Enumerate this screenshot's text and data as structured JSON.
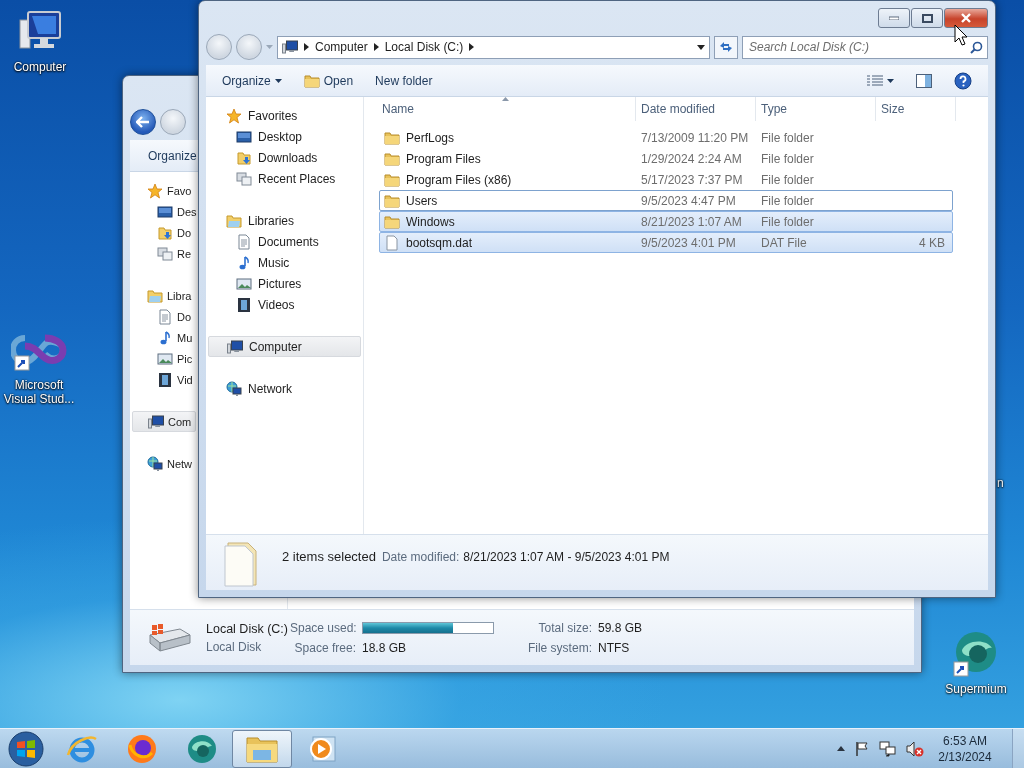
{
  "desktop_icons": [
    {
      "kind": "computer",
      "label": "Computer"
    },
    {
      "kind": "visual-studio",
      "label": "Microsoft Visual Stud..."
    },
    {
      "kind": "supermium",
      "label": "Supermium"
    },
    {
      "kind": "fragment",
      "label": "n"
    }
  ],
  "back_window": {
    "toolbar": {
      "organize": "Organize"
    },
    "nav": [
      {
        "kind": "star",
        "label": "Favo",
        "selected": false,
        "children": [
          {
            "kind": "desktop",
            "label": "Des",
            "selected": false
          },
          {
            "kind": "downloads",
            "label": "Do",
            "selected": false
          },
          {
            "kind": "recent",
            "label": "Re",
            "selected": false
          }
        ]
      },
      {
        "kind": "library",
        "label": "Libra",
        "selected": false,
        "children": [
          {
            "kind": "documents",
            "label": "Do",
            "selected": false
          },
          {
            "kind": "music",
            "label": "Mu",
            "selected": false
          },
          {
            "kind": "pictures",
            "label": "Pic",
            "selected": false
          },
          {
            "kind": "videos",
            "label": "Vid",
            "selected": false
          }
        ]
      },
      {
        "kind": "computer",
        "label": "Com",
        "selected": true
      },
      {
        "kind": "network",
        "label": "Netw",
        "selected": false
      }
    ],
    "drive": {
      "name": "Local Disk (C:)",
      "type": "Local Disk",
      "space_used_label": "Space used:",
      "level": 0.69,
      "space_free_label": "Space free:",
      "space_free": "18.8 GB",
      "total_size_label": "Total size:",
      "total_size": "59.8 GB",
      "file_system_label": "File system:",
      "file_system": "NTFS"
    }
  },
  "front_window": {
    "breadcrumb": [
      "Computer",
      "Local Disk (C:)"
    ],
    "search": {
      "placeholder": "Search Local Disk (C:)"
    },
    "toolbar": {
      "organize": "Organize",
      "open": "Open",
      "new_folder": "New folder"
    },
    "nav": [
      {
        "kind": "star",
        "label": "Favorites",
        "selected": false,
        "children": [
          {
            "kind": "desktop",
            "label": "Desktop",
            "selected": false
          },
          {
            "kind": "downloads",
            "label": "Downloads",
            "selected": false
          },
          {
            "kind": "recent",
            "label": "Recent Places",
            "selected": false
          }
        ]
      },
      {
        "kind": "library",
        "label": "Libraries",
        "selected": false,
        "children": [
          {
            "kind": "documents",
            "label": "Documents",
            "selected": false
          },
          {
            "kind": "music",
            "label": "Music",
            "selected": false
          },
          {
            "kind": "pictures",
            "label": "Pictures",
            "selected": false
          },
          {
            "kind": "videos",
            "label": "Videos",
            "selected": false
          }
        ]
      },
      {
        "kind": "computer",
        "label": "Computer",
        "selected": true
      },
      {
        "kind": "network",
        "label": "Network",
        "selected": false
      }
    ],
    "columns": [
      "Name",
      "Date modified",
      "Type",
      "Size"
    ],
    "files": [
      {
        "kind": "folder",
        "name": "PerfLogs",
        "date": "7/13/2009 11:20 PM",
        "type": "File folder",
        "selected": false,
        "focused": false
      },
      {
        "kind": "folder",
        "name": "Program Files",
        "date": "1/29/2024 2:24 AM",
        "type": "File folder",
        "selected": false,
        "focused": false
      },
      {
        "kind": "folder",
        "name": "Program Files (x86)",
        "date": "5/17/2023 7:37 PM",
        "type": "File folder",
        "selected": false,
        "focused": false
      },
      {
        "kind": "folder",
        "name": "Users",
        "date": "9/5/2023 4:47 PM",
        "type": "File folder",
        "selected": false,
        "focused": true
      },
      {
        "kind": "folder",
        "name": "Windows",
        "date": "8/21/2023 1:07 AM",
        "type": "File folder",
        "selected": true,
        "focused": false
      },
      {
        "kind": "file",
        "name": "bootsqm.dat",
        "date": "9/5/2023 4:01 PM",
        "type": "DAT File",
        "size": "4 KB",
        "selected": true,
        "focused": false
      }
    ],
    "details": {
      "summary": "2 items selected",
      "label": "Date modified:",
      "value": "8/21/2023 1:07 AM - 9/5/2023 4:01 PM"
    }
  },
  "taskbar": {
    "items": [
      {
        "kind": "start",
        "selected": false
      },
      {
        "kind": "browser-e",
        "selected": false
      },
      {
        "kind": "firefox",
        "selected": false
      },
      {
        "kind": "supermium",
        "selected": false
      },
      {
        "kind": "explorer",
        "selected": true
      },
      {
        "kind": "media",
        "selected": false
      }
    ],
    "clock": {
      "time": "6:53 AM",
      "date": "2/13/2024"
    }
  }
}
